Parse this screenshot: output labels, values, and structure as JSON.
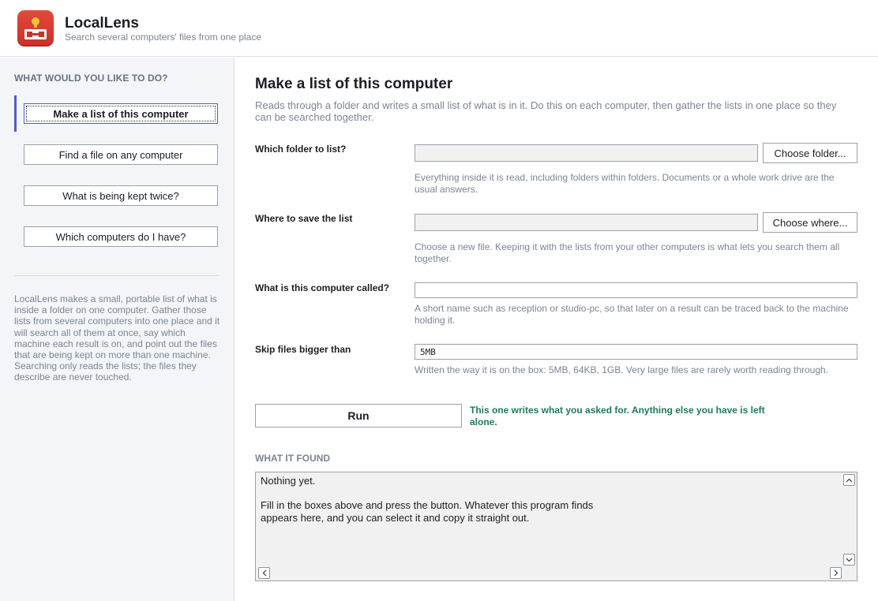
{
  "app": {
    "title": "LocalLens",
    "subtitle": "Search several computers' files from one place",
    "icon": "app-logo-icon",
    "brand_color": "#d83a2f"
  },
  "sidebar": {
    "heading": "WHAT WOULD YOU LIKE TO DO?",
    "items": [
      {
        "label": "Make a list of this computer",
        "active": true
      },
      {
        "label": "Find a file on any computer",
        "active": false
      },
      {
        "label": "What is being kept twice?",
        "active": false
      },
      {
        "label": "Which computers do I have?",
        "active": false
      }
    ],
    "about": "LocalLens makes a small, portable list of what is inside a folder on one computer. Gather those lists from several computers into one place and it will search all of them at once, say which machine each result is on, and point out the files that are being kept on more than one machine. Searching only reads the lists; the files they describe are never touched.",
    "accent_color": "#4a5fc1"
  },
  "main": {
    "title": "Make a list of this computer",
    "description": "Reads through a folder and writes a small list of what is in it. Do this on each computer, then gather the lists in one place so they can be searched together.",
    "fields": {
      "folder": {
        "label": "Which folder to list?",
        "value": "",
        "button": "Choose folder...",
        "help": "Everything inside it is read, including folders within folders. Documents or a whole work drive are the usual answers."
      },
      "save": {
        "label": "Where to save the list",
        "value": "",
        "button": "Choose where...",
        "help": "Choose a new file. Keeping it with the lists from your other computers is what lets you search them all together."
      },
      "name": {
        "label": "What is this computer called?",
        "value": "",
        "help": "A short name such as reception or studio-pc, so that later on a result can be traced back to the machine holding it."
      },
      "skip": {
        "label": "Skip files bigger than",
        "value": "5MB",
        "help": "Written the way it is on the box: 5MB, 64KB, 1GB. Very large files are rarely worth reading through."
      }
    },
    "run_button": "Run",
    "run_note": "This one writes what you asked for. Anything else you have is left alone.",
    "run_note_color": "#1f7a5a",
    "found_heading": "WHAT IT FOUND",
    "output": "Nothing yet.\n\nFill in the boxes above and press the button. Whatever this program finds\nappears here, and you can select it and copy it straight out."
  }
}
